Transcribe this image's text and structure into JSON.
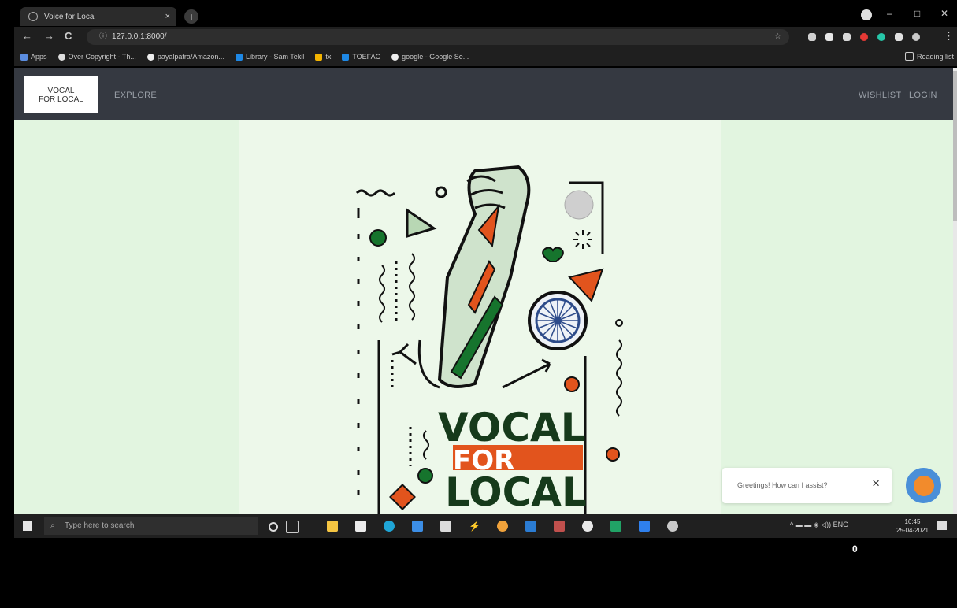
{
  "browser": {
    "tab_title": "Voice for Local",
    "tab_close": "×",
    "new_tab": "+",
    "window_min": "–",
    "window_max": "□",
    "window_close": "✕",
    "back": "←",
    "forward": "→",
    "reload": "C",
    "url": "127.0.0.1:8000/",
    "bookmarks": [
      "Apps",
      "Over Copyright - Th...",
      "payalpatra/Amazon...",
      "Library - Sam Tekil",
      "tx",
      "TOEFAC",
      "google - Google Se..."
    ],
    "reading_list": "Reading list"
  },
  "site": {
    "logo_line1": "VOCAL",
    "logo_line2": "FOR LOCAL",
    "nav_explore": "EXPLORE",
    "nav_wishlist": "WISHLIST",
    "nav_login": "LOGIN"
  },
  "poster": {
    "line1": "VOCAL",
    "line2": "FOR",
    "line3": "LOCAL"
  },
  "chat": {
    "greeting": "Greetings! How can I assist?",
    "close": "×"
  },
  "taskbar": {
    "search_placeholder": "Type here to search",
    "lang": "ENG",
    "time": "16:45",
    "date": "25-04-2021"
  },
  "overlay_counter": "0",
  "colors": {
    "saffron": "#e2541d",
    "green": "#16742d",
    "dark_green": "#163a1b",
    "chakra_blue": "#2d4b8a",
    "nav_bg": "#353941",
    "page_bg": "#e2f5e0"
  }
}
